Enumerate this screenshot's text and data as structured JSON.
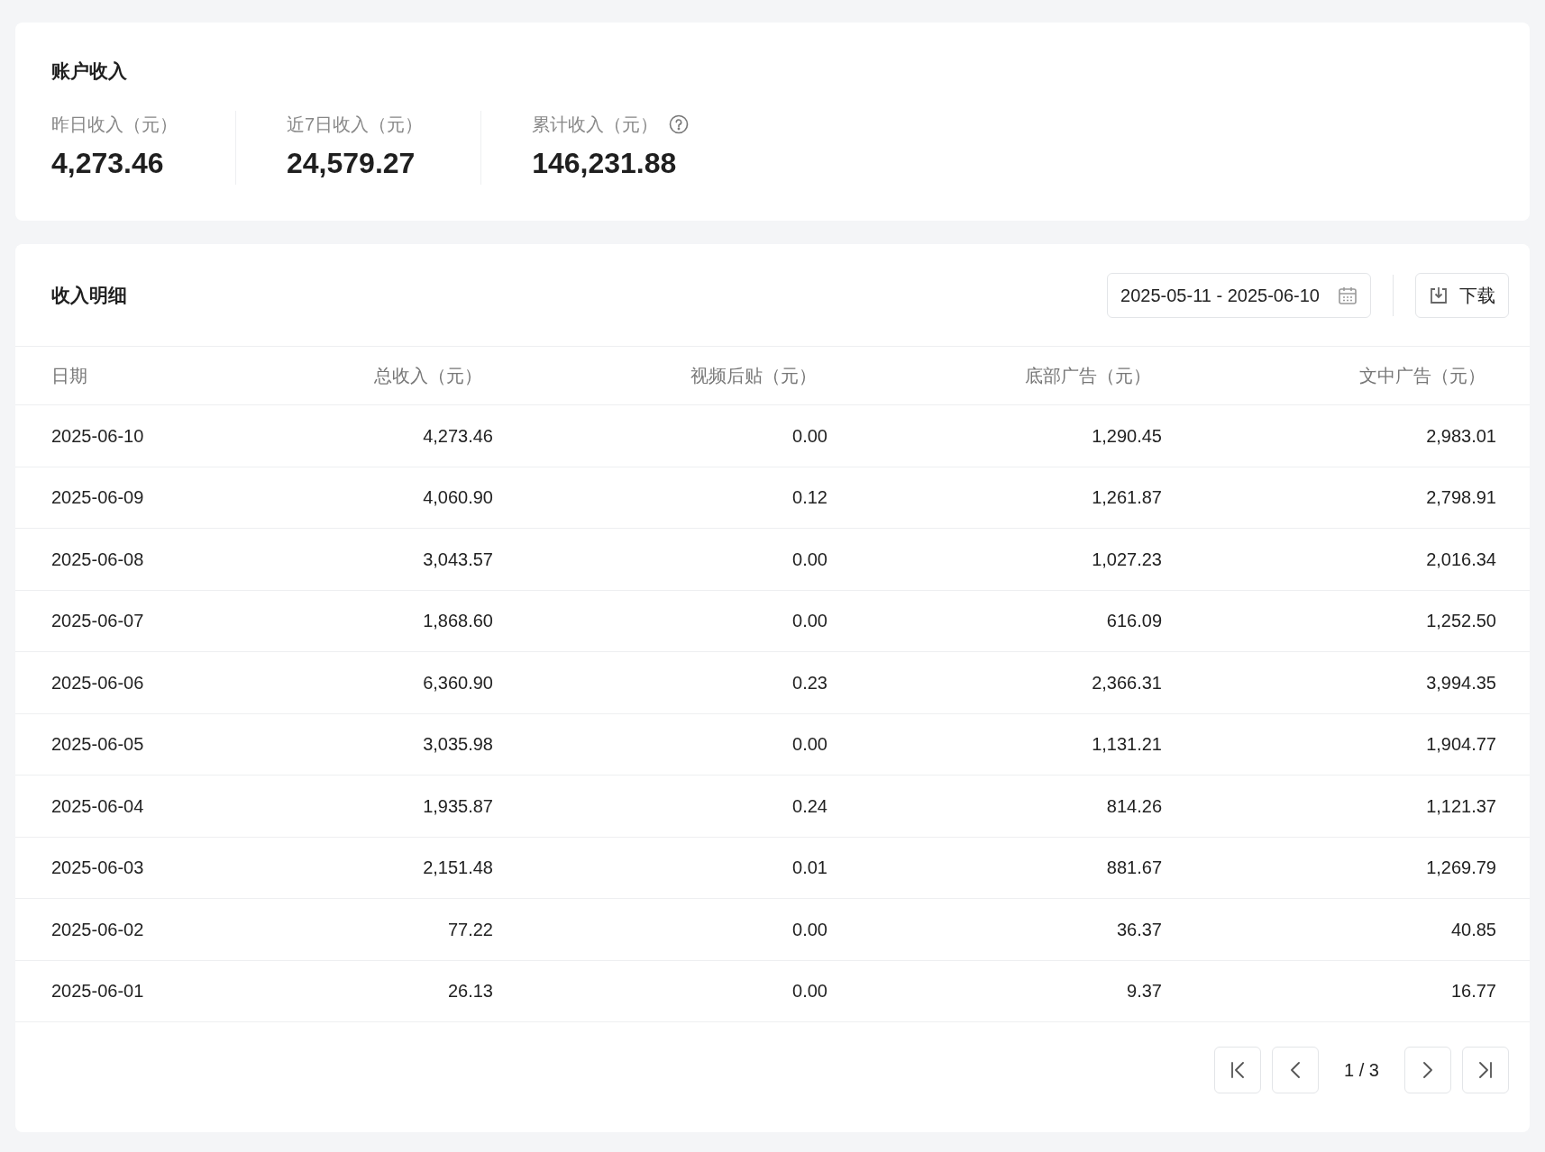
{
  "account": {
    "title": "账户收入",
    "stats": [
      {
        "label": "昨日收入（元）",
        "value": "4,273.46",
        "help": false
      },
      {
        "label": "近7日收入（元）",
        "value": "24,579.27",
        "help": false
      },
      {
        "label": "累计收入（元）",
        "value": "146,231.88",
        "help": true
      }
    ]
  },
  "details": {
    "title": "收入明细",
    "date_range": "2025-05-11 - 2025-06-10",
    "download": "下载",
    "table": {
      "columns": [
        "日期",
        "总收入（元）",
        "视频后贴（元）",
        "底部广告（元）",
        "文中广告（元）"
      ],
      "rows": [
        [
          "2025-06-10",
          "4,273.46",
          "0.00",
          "1,290.45",
          "2,983.01"
        ],
        [
          "2025-06-09",
          "4,060.90",
          "0.12",
          "1,261.87",
          "2,798.91"
        ],
        [
          "2025-06-08",
          "3,043.57",
          "0.00",
          "1,027.23",
          "2,016.34"
        ],
        [
          "2025-06-07",
          "1,868.60",
          "0.00",
          "616.09",
          "1,252.50"
        ],
        [
          "2025-06-06",
          "6,360.90",
          "0.23",
          "2,366.31",
          "3,994.35"
        ],
        [
          "2025-06-05",
          "3,035.98",
          "0.00",
          "1,131.21",
          "1,904.77"
        ],
        [
          "2025-06-04",
          "1,935.87",
          "0.24",
          "814.26",
          "1,121.37"
        ],
        [
          "2025-06-03",
          "2,151.48",
          "0.01",
          "881.67",
          "1,269.79"
        ],
        [
          "2025-06-02",
          "77.22",
          "0.00",
          "36.37",
          "40.85"
        ],
        [
          "2025-06-01",
          "26.13",
          "0.00",
          "9.37",
          "16.77"
        ]
      ]
    },
    "pagination": {
      "page": "1 / 3"
    }
  }
}
